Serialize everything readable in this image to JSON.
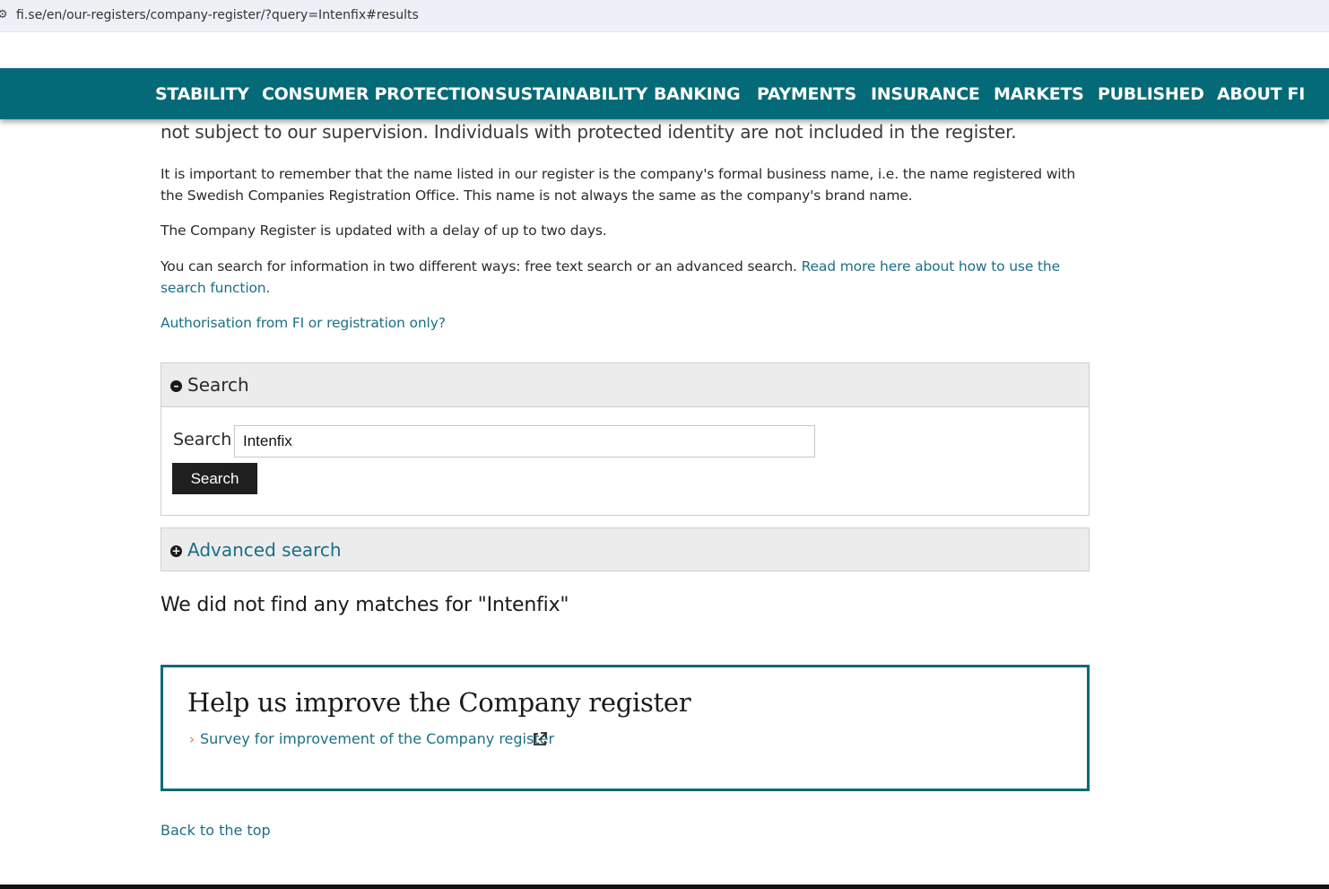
{
  "browser": {
    "url_icon": "site-info-icon",
    "url": "fi.se/en/our-registers/company-register/?query=Intenfix#results"
  },
  "nav": {
    "items": [
      "STABILITY",
      "CONSUMER PROTECTION",
      "SUSTAINABILITY",
      "BANKING",
      "PAYMENTS",
      "INSURANCE",
      "MARKETS",
      "PUBLISHED",
      "ABOUT FI"
    ],
    "background": "#046a78"
  },
  "content": {
    "intro_cut": "not subject to our supervision. Individuals with protected identity are not included in the register.",
    "para1": "It is important to remember that the name listed in our register is the company's formal business name, i.e. the name registered with the Swedish Companies Registration Office. This name is not always the same as the company's brand name.",
    "para2": "The Company Register is updated with a delay of up to two days.",
    "para3_text": "You can search for information in two different ways: free text search or an advanced search. ",
    "para3_link": "Read more here about how to use the search function.",
    "auth_link": "Authorisation from FI or registration only?"
  },
  "search_panel": {
    "title": "Search",
    "toggle_icon": "minus-circle-icon",
    "label": "Search",
    "value": "Intenfix",
    "button": "Search"
  },
  "advanced": {
    "title": "Advanced search",
    "toggle_icon": "plus-circle-icon"
  },
  "results": {
    "message": "We did not find any matches for \"Intenfix\""
  },
  "help": {
    "title": "Help us improve the Company register",
    "link": "Survey for improvement of the Company register",
    "link_icon": "external-link-icon"
  },
  "footer": {
    "back_to_top": "Back to the top"
  }
}
